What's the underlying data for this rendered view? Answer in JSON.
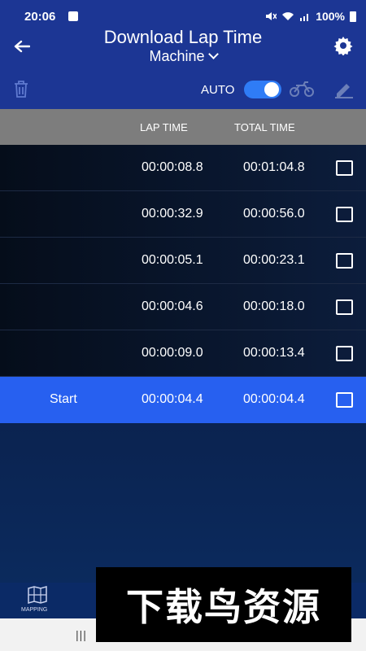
{
  "status": {
    "time": "20:06",
    "battery": "100%"
  },
  "header": {
    "title": "Download Lap Time",
    "subtitle": "Machine"
  },
  "toolbar": {
    "auto_label": "AUTO",
    "auto_on": true
  },
  "table": {
    "columns": [
      "LAP TIME",
      "TOTAL TIME"
    ],
    "rows": [
      {
        "label": "",
        "lap": "00:00:08.8",
        "total": "00:01:04.8",
        "checked": false
      },
      {
        "label": "",
        "lap": "00:00:32.9",
        "total": "00:00:56.0",
        "checked": false
      },
      {
        "label": "",
        "lap": "00:00:05.1",
        "total": "00:00:23.1",
        "checked": false
      },
      {
        "label": "",
        "lap": "00:00:04.6",
        "total": "00:00:18.0",
        "checked": false
      },
      {
        "label": "",
        "lap": "00:00:09.0",
        "total": "00:00:13.4",
        "checked": false
      },
      {
        "label": "Start",
        "lap": "00:00:04.4",
        "total": "00:00:04.4",
        "checked": false
      }
    ]
  },
  "bottom_nav": {
    "mapping_label": "MAPPING"
  },
  "watermark": {
    "text": "下载鸟资源"
  },
  "colors": {
    "primary": "#1c3694",
    "accent": "#2f7cf6",
    "active_row": "#2760f0",
    "header_row": "#7d7d7d"
  },
  "icons": [
    "back-arrow-icon",
    "gear-icon",
    "trash-icon",
    "motorcycle-icon",
    "pencil-icon",
    "map-grid-icon",
    "recent-apps-icon"
  ]
}
